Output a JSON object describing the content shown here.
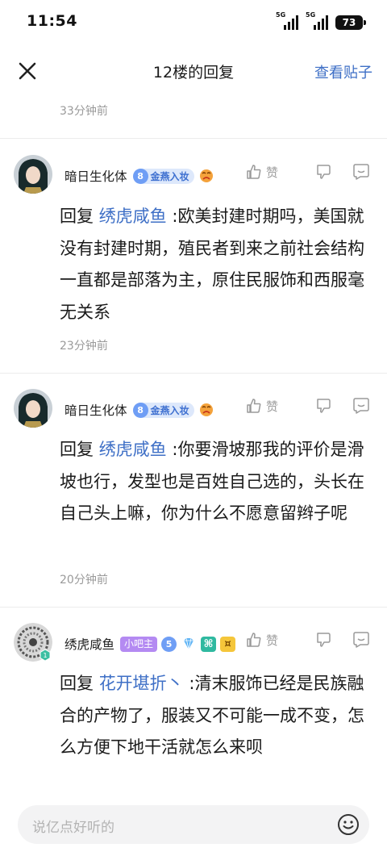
{
  "status_bar": {
    "time": "11:54",
    "signal1_label": "5G",
    "signal2_label": "5G",
    "battery": "73"
  },
  "nav": {
    "title": "12楼的回复",
    "action": "查看贴子"
  },
  "top_time": "33分钟前",
  "replies": [
    {
      "username": "暗日生化体",
      "level": "8",
      "level_title": "金燕入妆",
      "like_label": "赞",
      "prefix": "回复",
      "mention": "绣虎咸鱼",
      "text": ":欧美封建时期吗，美国就没有封建时期，殖民者到来之前社会结构一直都是部落为主，原住民服饰和西服毫无关系",
      "time": "23分钟前"
    },
    {
      "username": "暗日生化体",
      "level": "8",
      "level_title": "金燕入妆",
      "like_label": "赞",
      "prefix": "回复",
      "mention": "绣虎咸鱼",
      "text": ":你要滑坡那我的评价是滑坡也行，发型也是百姓自己选的，头长在自己头上嘛，你为什么不愿意留辫子呢",
      "time": "20分钟前"
    },
    {
      "username": "绣虎咸鱼",
      "badge": "小吧主",
      "level": "5",
      "like_label": "赞",
      "prefix": "回复",
      "mention": "花开堪折丶",
      "text": ":清末服饰已经是民族融合的产物了，服装又不可能一成不变，怎么方便下地干活就怎么来呗"
    }
  ],
  "input": {
    "placeholder": "说亿点好听的"
  },
  "colors": {
    "link": "#3e6fc6",
    "level_badge": "#6f9ef5",
    "owner_badge": "#b48af2"
  }
}
